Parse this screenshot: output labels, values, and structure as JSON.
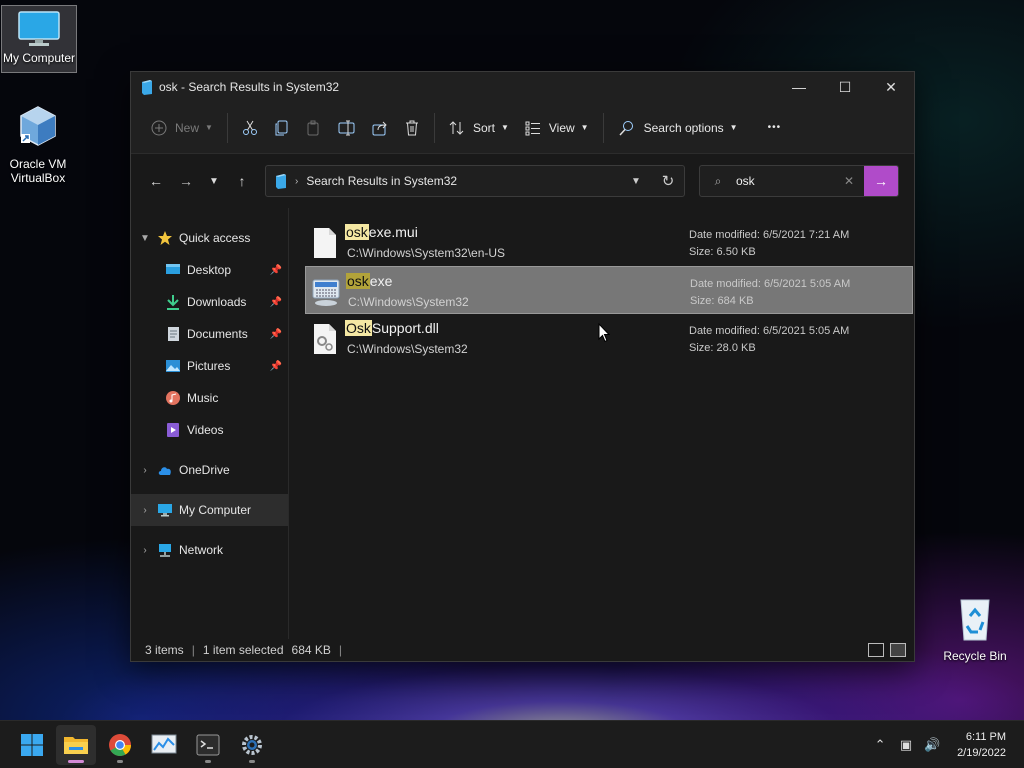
{
  "desktop": {
    "icons": [
      {
        "label": "My Computer"
      },
      {
        "label": "Oracle VM VirtualBox"
      },
      {
        "label": "Recycle Bin"
      }
    ]
  },
  "window": {
    "title": "osk - Search Results in System32",
    "controls": {
      "minimize": "—",
      "maximize": "☐",
      "close": "✕"
    }
  },
  "toolbar": {
    "new_label": "New",
    "sort_label": "Sort",
    "view_label": "View",
    "search_options_label": "Search options",
    "more_label": "•••"
  },
  "address": {
    "path": "Search Results in System32"
  },
  "search": {
    "query": "osk"
  },
  "nav": {
    "quick_access": "Quick access",
    "items": [
      {
        "label": "Desktop",
        "icon": "desktop-icon"
      },
      {
        "label": "Downloads",
        "icon": "download-icon"
      },
      {
        "label": "Documents",
        "icon": "documents-icon"
      },
      {
        "label": "Pictures",
        "icon": "pictures-icon"
      },
      {
        "label": "Music",
        "icon": "music-icon"
      },
      {
        "label": "Videos",
        "icon": "videos-icon"
      }
    ],
    "onedrive": "OneDrive",
    "my_computer": "My Computer",
    "network": "Network"
  },
  "results": [
    {
      "match": "osk",
      "rest": "exe.mui",
      "location": "C:\\Windows\\System32\\en-US",
      "date_label": "Date modified:",
      "date": "6/5/2021 7:21 AM",
      "size_label": "Size:",
      "size": "6.50 KB",
      "selected": false
    },
    {
      "match": "osk",
      "rest": "exe",
      "location": "C:\\Windows\\System32",
      "date_label": "Date modified:",
      "date": "6/5/2021 5:05 AM",
      "size_label": "Size:",
      "size": "684 KB",
      "selected": true
    },
    {
      "match": "Osk",
      "rest": "Support.dll",
      "location": "C:\\Windows\\System32",
      "date_label": "Date modified:",
      "date": "6/5/2021 5:05 AM",
      "size_label": "Size:",
      "size": "28.0 KB",
      "selected": false
    }
  ],
  "status": {
    "items": "3 items",
    "selected": "1 item selected",
    "size": "684 KB",
    "pipe": "|"
  },
  "taskbar": {
    "time": "6:11 PM",
    "date": "2/19/2022"
  },
  "colors": {
    "accent": "#b04bc9",
    "highlight": "#f5e8a3",
    "selection": "#777777"
  }
}
